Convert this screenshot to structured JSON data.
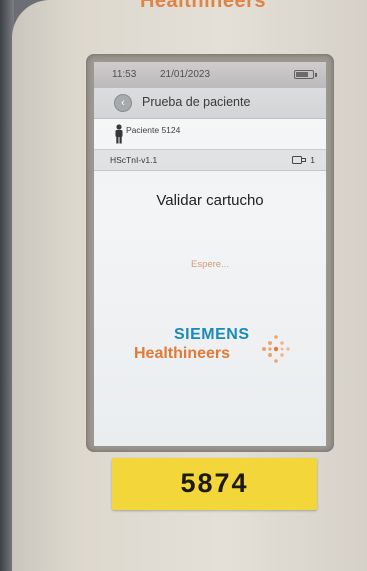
{
  "brand_top": "Healthineers",
  "status": {
    "time": "11:53",
    "date": "21/01/2023",
    "battery_level": 0.85
  },
  "header": {
    "title": "Prueba de paciente",
    "back_icon": "chevron-left-icon"
  },
  "patient": {
    "label": "Paciente 5124",
    "icon": "person-icon"
  },
  "test": {
    "name": "HScTnI-v1.1",
    "cartridge_icon": "cartridge-icon",
    "cartridge_count": "1"
  },
  "main": {
    "heading": "Validar cartucho",
    "wait_text": "Espere..."
  },
  "logo": {
    "line1": "SIEMENS",
    "line2": "Healthineers",
    "color_blue": "#1c8ab8",
    "color_orange": "#e07a37"
  },
  "device_label": "5874"
}
